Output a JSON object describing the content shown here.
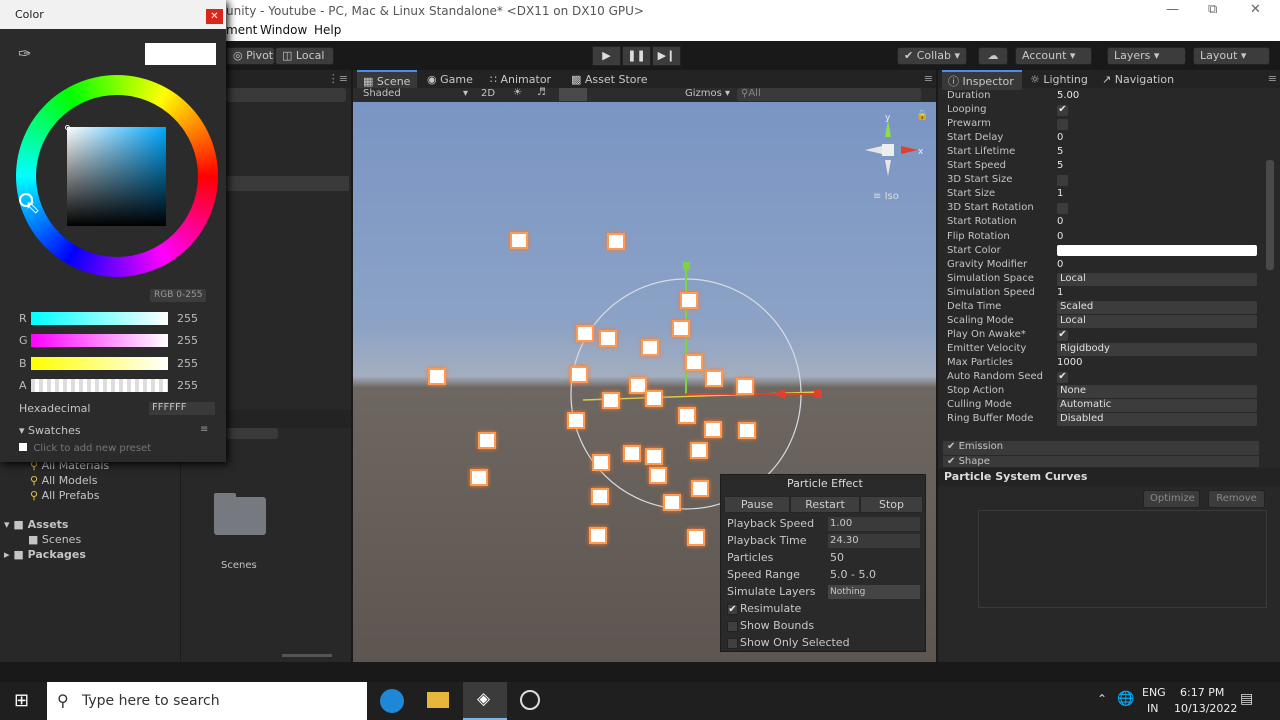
{
  "window": {
    "title": "unity - Youtube - PC, Mac & Linux Standalone* <DX11 on DX10 GPU>",
    "menu": [
      "ment",
      "Window",
      "Help"
    ]
  },
  "toolbar": {
    "pivot": "Pivot",
    "local": "Local",
    "collab": "Collab",
    "account": "Account",
    "layers": "Layers",
    "layout": "Layout"
  },
  "color_picker": {
    "title": "Color",
    "mode": "RGB 0-255",
    "channels": [
      {
        "label": "R",
        "value": "255"
      },
      {
        "label": "G",
        "value": "255"
      },
      {
        "label": "B",
        "value": "255"
      },
      {
        "label": "A",
        "value": "255"
      }
    ],
    "hex_label": "Hexadecimal",
    "hex_value": "FFFFFF",
    "swatches_label": "Swatches",
    "swatches_hint": "Click to add new preset"
  },
  "scene_tabs": [
    "Scene",
    "Game",
    "Animator",
    "Asset Store"
  ],
  "scene_bar": {
    "shading": "Shaded",
    "mode_2d": "2D",
    "gizmos": "Gizmos",
    "search_placeholder": "All",
    "projection": "Iso"
  },
  "project": {
    "favorites": [
      "All Materials",
      "All Models",
      "All Prefabs"
    ],
    "tree": [
      {
        "label": "Assets",
        "child": "Scenes"
      },
      {
        "label": "Packages"
      }
    ],
    "folder_label": "Scenes"
  },
  "inspector": {
    "tabs": [
      "Inspector",
      "Lighting",
      "Navigation"
    ],
    "rows": [
      {
        "label": "Duration",
        "value": "5.00"
      },
      {
        "label": "Looping",
        "check": true
      },
      {
        "label": "Prewarm",
        "check": false
      },
      {
        "label": "Start Delay",
        "value": "0"
      },
      {
        "label": "Start Lifetime",
        "value": "5"
      },
      {
        "label": "Start Speed",
        "value": "5"
      },
      {
        "label": "3D Start Size",
        "check": false
      },
      {
        "label": "Start Size",
        "value": "1"
      },
      {
        "label": "3D Start Rotation",
        "check": false
      },
      {
        "label": "Start Rotation",
        "value": "0"
      },
      {
        "label": "Flip Rotation",
        "value": "0"
      },
      {
        "label": "Start Color",
        "value": ""
      },
      {
        "label": "Gravity Modifier",
        "value": "0"
      },
      {
        "label": "Simulation Space",
        "dropdown": "Local"
      },
      {
        "label": "Simulation Speed",
        "value": "1"
      },
      {
        "label": "Delta Time",
        "dropdown": "Scaled"
      },
      {
        "label": "Scaling Mode",
        "dropdown": "Local"
      },
      {
        "label": "Play On Awake*",
        "check": true
      },
      {
        "label": "Emitter Velocity",
        "dropdown": "Rigidbody"
      },
      {
        "label": "Max Particles",
        "value": "1000"
      },
      {
        "label": "Auto Random Seed",
        "check": true
      },
      {
        "label": "Stop Action",
        "dropdown": "None"
      },
      {
        "label": "Culling Mode",
        "dropdown": "Automatic"
      },
      {
        "label": "Ring Buffer Mode",
        "dropdown": "Disabled"
      }
    ],
    "modules": [
      "Emission",
      "Shape"
    ],
    "curves_title": "Particle System Curves",
    "optimize": "Optimize",
    "remove": "Remove"
  },
  "particle_effect": {
    "title": "Particle Effect",
    "buttons": [
      "Pause",
      "Restart",
      "Stop"
    ],
    "rows": [
      {
        "label": "Playback Speed",
        "value": "1.00"
      },
      {
        "label": "Playback Time",
        "value": "24.30"
      },
      {
        "label": "Particles",
        "value": "50"
      },
      {
        "label": "Speed Range",
        "value": "5.0 - 5.0"
      },
      {
        "label": "Simulate Layers",
        "value": "Nothing"
      }
    ],
    "checks": [
      {
        "label": "Resimulate",
        "checked": true
      },
      {
        "label": "Show Bounds",
        "checked": false
      },
      {
        "label": "Show Only Selected",
        "checked": false
      }
    ]
  },
  "taskbar": {
    "search_placeholder": "Type here to search",
    "lang1": "ENG",
    "lang2": "IN",
    "time": "6:17 PM",
    "date": "10/13/2022"
  }
}
